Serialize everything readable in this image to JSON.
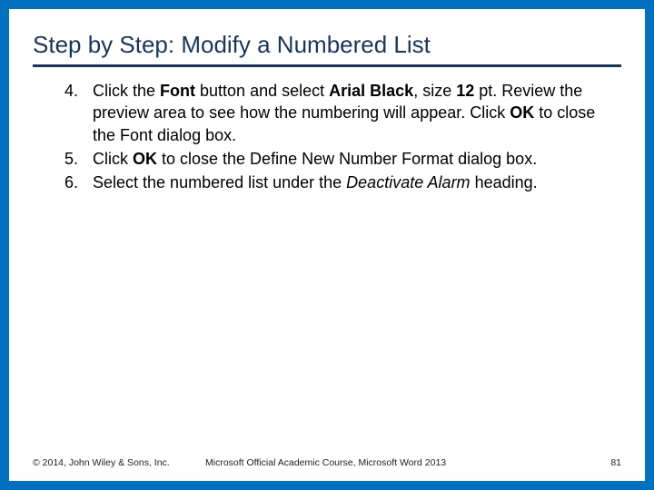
{
  "title": "Step by Step: Modify a Numbered List",
  "steps": [
    {
      "num": "4.",
      "segments": [
        {
          "t": "Click the "
        },
        {
          "t": "Font",
          "b": true
        },
        {
          "t": " button and select "
        },
        {
          "t": "Arial Black",
          "b": true
        },
        {
          "t": ", size "
        },
        {
          "t": "12",
          "b": true
        },
        {
          "t": " pt. Review the preview area to see how the numbering will appear. Click "
        },
        {
          "t": "OK",
          "b": true
        },
        {
          "t": " to close the Font dialog box."
        }
      ]
    },
    {
      "num": "5.",
      "segments": [
        {
          "t": "Click "
        },
        {
          "t": "OK",
          "b": true
        },
        {
          "t": " to close the Define New Number Format dialog box."
        }
      ]
    },
    {
      "num": "6.",
      "segments": [
        {
          "t": "Select the numbered list under the "
        },
        {
          "t": "Deactivate Alarm",
          "i": true
        },
        {
          "t": " heading."
        }
      ]
    }
  ],
  "footer": {
    "left": "© 2014, John Wiley & Sons, Inc.",
    "center": "Microsoft Official Academic Course, Microsoft Word 2013",
    "right": "81"
  }
}
